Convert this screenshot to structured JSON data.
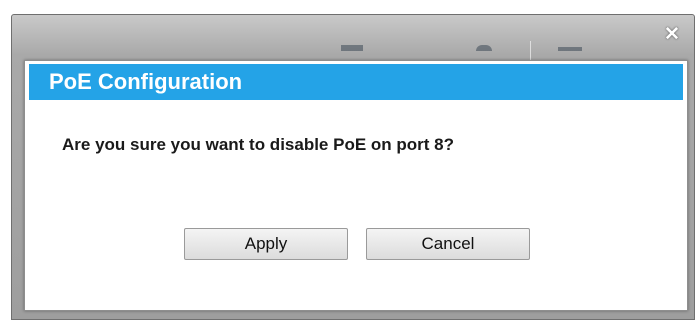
{
  "window": {
    "close_glyph": "✕"
  },
  "dialog": {
    "title": "PoE Configuration",
    "message": "Are you sure you want to disable PoE on port 8?",
    "apply_label": "Apply",
    "cancel_label": "Cancel"
  },
  "colors": {
    "header": "#24a3e7",
    "frame": "#a9a9a9"
  }
}
